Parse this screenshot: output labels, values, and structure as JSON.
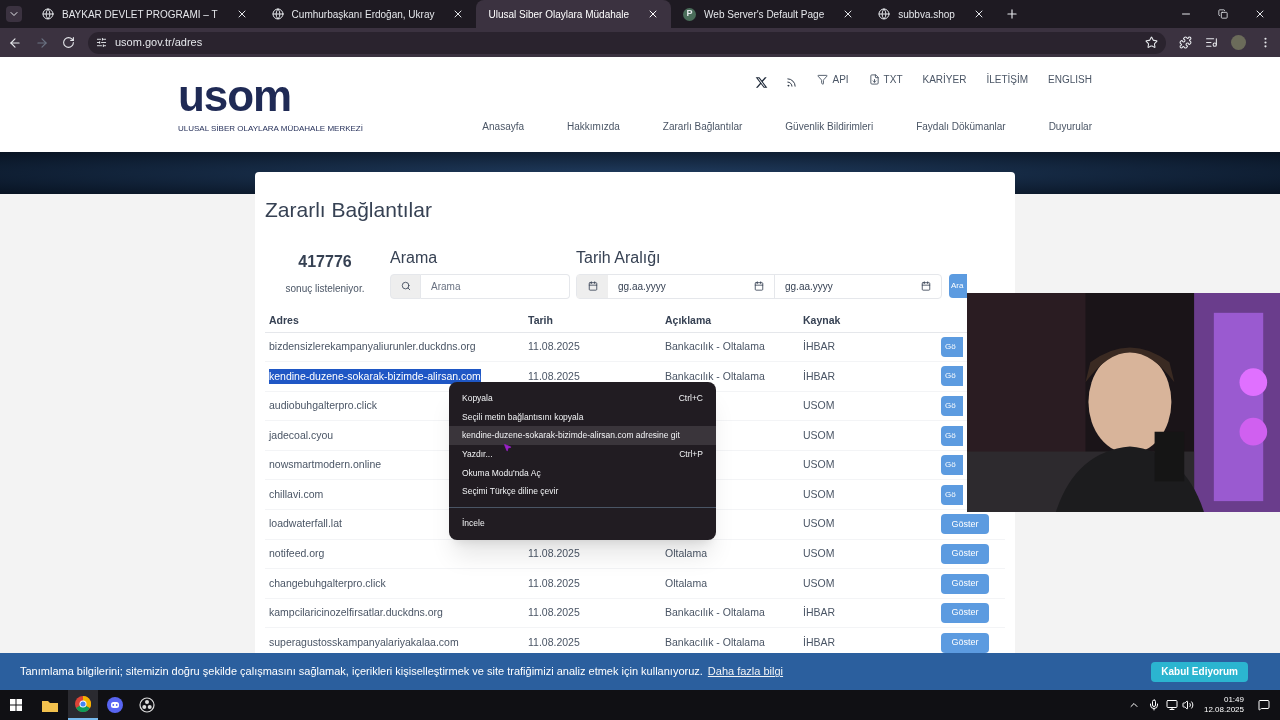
{
  "browser": {
    "tabs": [
      {
        "title": "BAYKAR DEVLET PROGRAMI – T",
        "selected": false,
        "kind": "globe"
      },
      {
        "title": "Cumhurbaşkanı Erdoğan, Ukray",
        "selected": false,
        "kind": "globe"
      },
      {
        "title": "Ulusal Siber Olaylara Müdahale",
        "selected": true,
        "kind": "plain"
      },
      {
        "title": "Web Server's Default Page",
        "selected": false,
        "kind": "letter",
        "favicon_letter": "P"
      },
      {
        "title": "subbva.shop",
        "selected": false,
        "kind": "globe"
      }
    ],
    "url": "usom.gov.tr/adres"
  },
  "header": {
    "logo": {
      "wordmark": "usom",
      "subtitle": "ULUSAL SİBER OLAYLARA MÜDAHALE MERKEZİ"
    },
    "top_links": [
      {
        "label": "API",
        "kind": "filter"
      },
      {
        "label": "TXT",
        "kind": "download"
      },
      {
        "label": "KARİYER",
        "kind": "plain"
      },
      {
        "label": "İLETİŞİM",
        "kind": "plain"
      },
      {
        "label": "ENGLISH",
        "kind": "plain"
      }
    ],
    "nav": [
      "Anasayfa",
      "Hakkımızda",
      "Zararlı Bağlantılar",
      "Güvenlik Bildirimleri",
      "Faydalı Dökümanlar",
      "Duyurular"
    ]
  },
  "content": {
    "title": "Zararlı Bağlantılar",
    "count": "417776",
    "count_label": "sonuç listeleniyor.",
    "search_label": "Arama",
    "search_placeholder": "Arama",
    "date_label": "Tarih Aralığı",
    "date_from_placeholder": "gg.aa.yyyy",
    "date_to_placeholder": "gg.aa.yyyy",
    "search_button": "Ara"
  },
  "table": {
    "columns": [
      "Adres",
      "Tarih",
      "Açıklama",
      "Kaynak"
    ],
    "rows": [
      {
        "address": "bizdensizlerekampanyaliurunler.duckdns.org",
        "date": "11.08.2025",
        "description": "Bankacılık - Oltalama",
        "source": "İHBAR",
        "button": "Gö",
        "kind": "partial",
        "selected": false
      },
      {
        "address": "kendine-duzene-sokarak-bizimde-alirsan.com",
        "date": "11.08.2025",
        "description": "Bankacılık - Oltalama",
        "source": "İHBAR",
        "button": "Gö",
        "kind": "partial",
        "selected": true
      },
      {
        "address": "audiobuhgalterpro.click",
        "source": "USOM",
        "button": "Gö",
        "kind": "partial",
        "selected": false
      },
      {
        "address": "jadecoal.cyou",
        "source": "USOM",
        "button": "Gö",
        "kind": "partial",
        "selected": false
      },
      {
        "address": "nowsmartmodern.online",
        "source": "USOM",
        "button": "Gö",
        "kind": "partial",
        "selected": false
      },
      {
        "address": "chillavi.com",
        "source": "USOM",
        "button": "Gö",
        "kind": "partial",
        "selected": false
      },
      {
        "address": "loadwaterfall.lat",
        "source": "USOM",
        "button": "Göster",
        "kind": "full",
        "selected": false
      },
      {
        "address": "notifeed.org",
        "date": "11.08.2025",
        "description": "Oltalama",
        "source": "USOM",
        "button": "Göster",
        "kind": "full",
        "selected": false
      },
      {
        "address": "changebuhgalterpro.click",
        "date": "11.08.2025",
        "description": "Oltalama",
        "source": "USOM",
        "button": "Göster",
        "kind": "full",
        "selected": false
      },
      {
        "address": "kampcilaricinozelfirsatlar.duckdns.org",
        "date": "11.08.2025",
        "description": "Bankacılık - Oltalama",
        "source": "İHBAR",
        "button": "Göster",
        "kind": "full",
        "selected": false
      },
      {
        "address": "superagustosskampanyalariyakalaa.com",
        "date": "11.08.2025",
        "description": "Bankacılık - Oltalama",
        "source": "İHBAR",
        "button": "Göster",
        "kind": "full",
        "selected": false
      }
    ]
  },
  "context_menu": [
    {
      "label": "Kopyala",
      "shortcut": "Ctrl+C",
      "selected": false,
      "separator_before": false
    },
    {
      "label": "Seçili metin bağlantısını kopyala",
      "selected": false,
      "separator_before": false
    },
    {
      "label": "kendine-duzene-sokarak-bizimde-alirsan.com adresine git",
      "selected": true,
      "separator_before": false
    },
    {
      "label": "Yazdır...",
      "shortcut": "Ctrl+P",
      "selected": false,
      "separator_before": false
    },
    {
      "label": "Okuma Modu'nda Aç",
      "selected": false,
      "separator_before": false
    },
    {
      "label": "Seçimi Türkçe diline çevir",
      "selected": false,
      "separator_before": false
    },
    {
      "label": "İncele",
      "selected": false,
      "separator_before": true
    }
  ],
  "cookie_bar": {
    "text": "Tanımlama bilgilerini; sitemizin doğru şekilde çalışmasını sağlamak, içerikleri kişiselleştirmek ve site trafiğimizi analiz etmek için kullanıyoruz.",
    "link": "Daha fazla bilgi",
    "button": "Kabul Ediyorum"
  },
  "taskbar": {
    "time": "01:49",
    "date": "12.08.2025"
  }
}
